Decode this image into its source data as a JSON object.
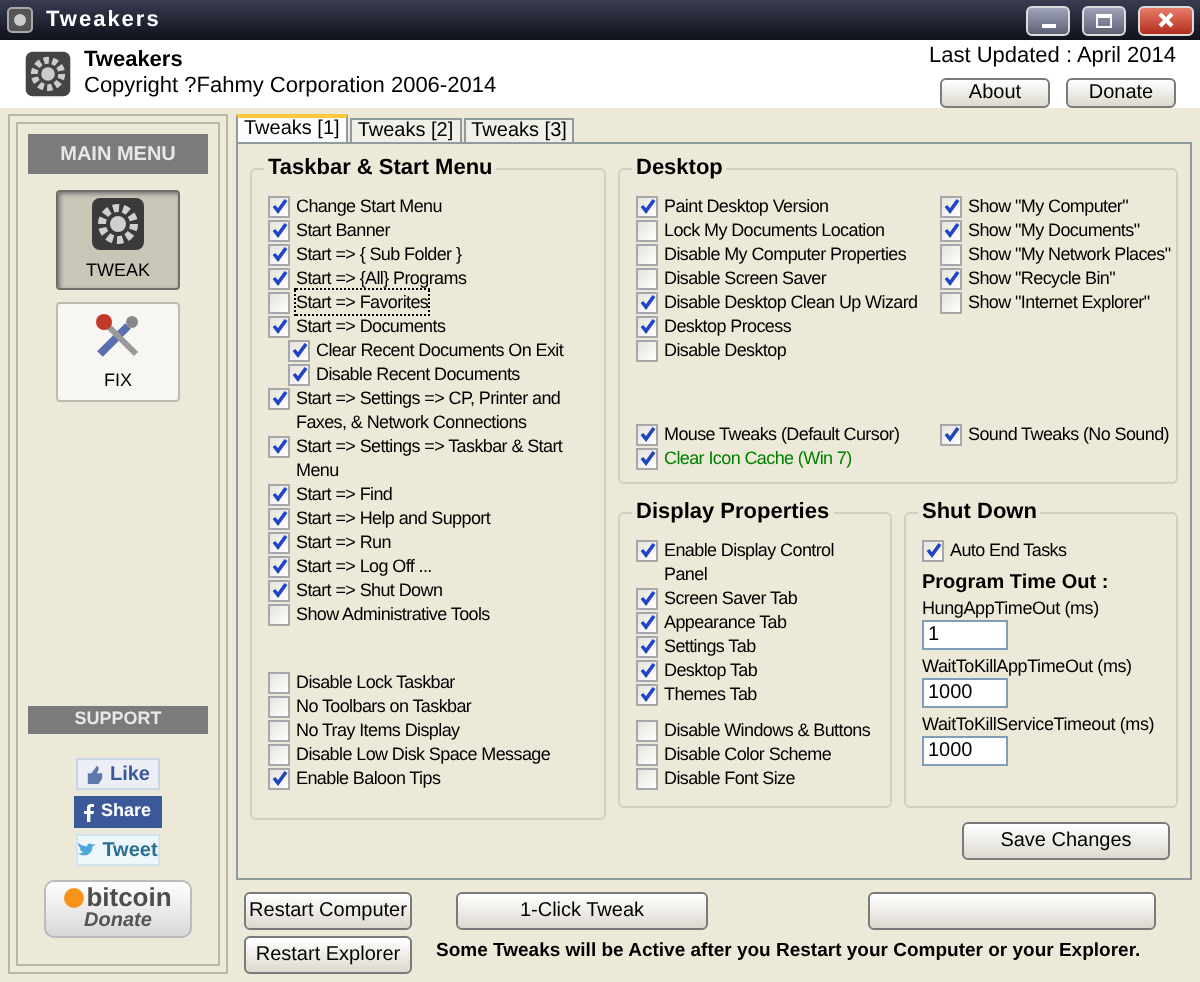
{
  "window": {
    "title": "Tweakers"
  },
  "header": {
    "app_name": "Tweakers",
    "copyright": "Copyright ?Fahmy Corporation 2006-2014",
    "last_updated": "Last Updated : April 2014",
    "buttons": [
      "About",
      "Donate"
    ]
  },
  "sidebar": {
    "main_menu_title": "MAIN MENU",
    "items": [
      {
        "kind": "tweak",
        "label": "TWEAK",
        "selected": true
      },
      {
        "kind": "fix",
        "label": "FIX",
        "selected": false
      }
    ],
    "support_title": "SUPPORT",
    "social": [
      {
        "kind": "like",
        "label": "Like"
      },
      {
        "kind": "share",
        "label": "Share"
      },
      {
        "kind": "tweet",
        "label": "Tweet"
      }
    ],
    "bitcoin": {
      "label": "bitcoin",
      "sub": "Donate"
    }
  },
  "tabs": [
    {
      "label": "Tweaks [1]",
      "selected": true
    },
    {
      "label": "Tweaks [2]",
      "selected": false
    },
    {
      "label": "Tweaks [3]",
      "selected": false
    }
  ],
  "taskbar": {
    "title": "Taskbar & Start Menu",
    "items": [
      {
        "label": "Change Start Menu",
        "checked": true
      },
      {
        "label": "Start Banner",
        "checked": true
      },
      {
        "label": "Start => { Sub Folder }",
        "checked": true
      },
      {
        "label": "Start => {All} Programs",
        "checked": true
      },
      {
        "label": "Start => Favorites",
        "checked": false,
        "focused": true
      },
      {
        "label": "Start => Documents",
        "checked": true,
        "children": [
          {
            "label": "Clear Recent Documents On Exit",
            "checked": true
          },
          {
            "label": "Disable Recent Documents",
            "checked": true
          }
        ]
      },
      {
        "label": "Start => Settings => CP, Printer and Faxes, & Network Connections",
        "checked": true
      },
      {
        "label": "Start => Settings => Taskbar & Start Menu",
        "checked": true
      },
      {
        "label": "Start => Find",
        "checked": true
      },
      {
        "label": "Start => Help and Support",
        "checked": true
      },
      {
        "label": "Start => Run",
        "checked": true
      },
      {
        "label": "Start => Log Off ...",
        "checked": true
      },
      {
        "label": "Start => Shut Down",
        "checked": true
      },
      {
        "label": "Show Administrative Tools",
        "checked": false
      }
    ],
    "more_items": [
      {
        "label": "Disable Lock Taskbar",
        "checked": false
      },
      {
        "label": "No Toolbars on Taskbar",
        "checked": false
      },
      {
        "label": "No Tray Items Display",
        "checked": false
      },
      {
        "label": "Disable Low Disk Space Message",
        "checked": false
      },
      {
        "label": "Enable Baloon Tips",
        "checked": true
      }
    ]
  },
  "desktop": {
    "title": "Desktop",
    "column_1": [
      {
        "label": "Paint Desktop Version",
        "checked": true
      },
      {
        "label": "Lock My Documents Location",
        "checked": false
      },
      {
        "label": "Disable My Computer Properties",
        "checked": false
      },
      {
        "label": "Disable Screen Saver",
        "checked": false
      },
      {
        "label": "Disable Desktop Clean Up Wizard",
        "checked": true
      },
      {
        "label": "Desktop Process",
        "checked": true
      },
      {
        "label": "Disable Desktop",
        "checked": false
      }
    ],
    "column_2": [
      {
        "label": "Show \"My Computer\"",
        "checked": true
      },
      {
        "label": "Show \"My Documents\"",
        "checked": true
      },
      {
        "label": "Show \"My Network Places\"",
        "checked": false
      },
      {
        "label": "Show \"Recycle Bin\"",
        "checked": true
      },
      {
        "label": "Show \"Internet Explorer\"",
        "checked": false
      }
    ],
    "extra": [
      {
        "label": "Mouse Tweaks (Default Cursor)",
        "checked": true,
        "color": "#000000"
      },
      {
        "label": "Sound Tweaks (No Sound)",
        "checked": true,
        "color": "#000000"
      },
      {
        "label": "Clear Icon Cache (Win 7)",
        "checked": true,
        "color": "#008000"
      }
    ]
  },
  "display": {
    "title": "Display Properties",
    "items": [
      {
        "label": "Enable Display Control Panel",
        "checked": true
      },
      {
        "label": "Screen Saver Tab",
        "checked": true
      },
      {
        "label": "Appearance Tab",
        "checked": true
      },
      {
        "label": "Settings Tab",
        "checked": true
      },
      {
        "label": "Desktop Tab",
        "checked": true
      },
      {
        "label": "Themes Tab",
        "checked": true
      }
    ],
    "more_items": [
      {
        "label": "Disable Windows & Buttons",
        "checked": false
      },
      {
        "label": "Disable Color Scheme",
        "checked": false
      },
      {
        "label": "Disable Font Size",
        "checked": false
      }
    ]
  },
  "shutdown": {
    "title": "Shut Down",
    "auto_end": {
      "label": "Auto End Tasks",
      "checked": true
    },
    "timeout_title": "Program Time Out :",
    "fields": [
      {
        "label": "HungAppTimeOut (ms)",
        "value": "1"
      },
      {
        "label": "WaitToKillAppTimeOut (ms)",
        "value": "1000"
      },
      {
        "label": "WaitToKillServiceTimeout (ms)",
        "value": "1000"
      }
    ]
  },
  "save_button": "Save Changes",
  "bottom": {
    "restart_computer": "Restart Computer",
    "restart_explorer": "Restart Explorer",
    "one_click": "1-Click Tweak",
    "note": "Some Tweaks will be Active after you Restart your Computer or your Explorer."
  }
}
